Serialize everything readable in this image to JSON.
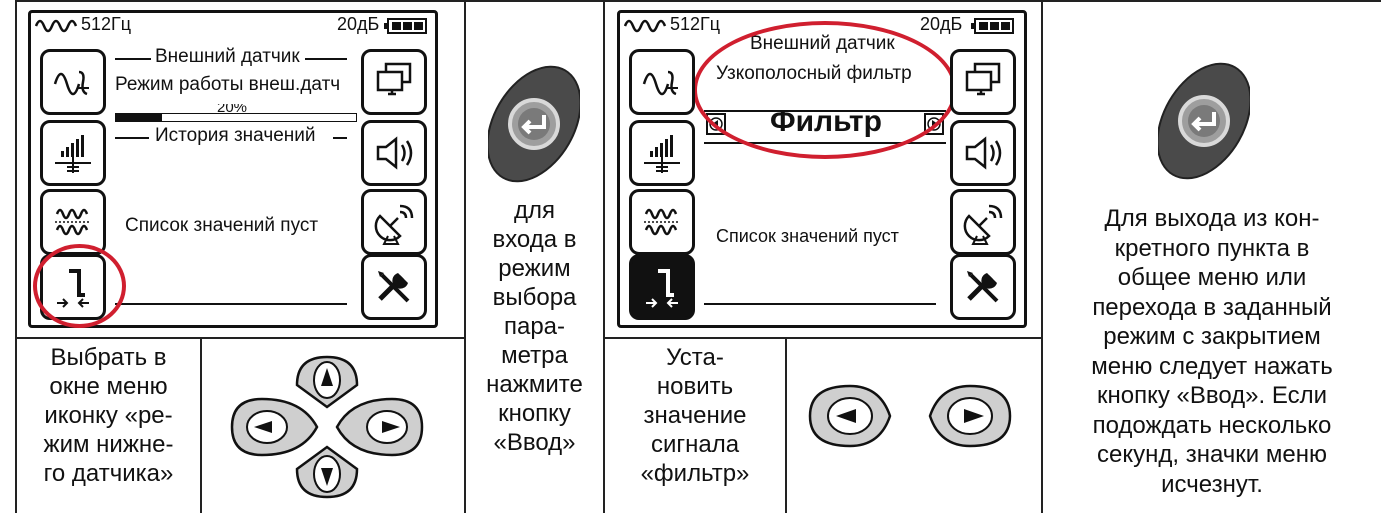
{
  "screen1": {
    "freq": "512Гц",
    "gain": "20дБ",
    "menu_title": "Внешний датчик",
    "menu_item": "Режим работы внеш.датч",
    "percent_partial": "20%",
    "history_title": "История значений",
    "empty_list": "Список значений пуст"
  },
  "screen2": {
    "freq": "512Гц",
    "gain": "20дБ",
    "menu_title": "Внешний датчик",
    "menu_item": "Узкополосный фильтр",
    "value": "Фильтр",
    "empty_list": "Список значений пуст"
  },
  "instructions": {
    "select_icon": "Выбрать в\nокне меню\nиконку «ре-\nжим нижне-\nго датчика»",
    "enter_mode": "для\nвхода в\nрежим\nвыбора\nпара-\nметра\nнажмите\nкнопку\n«Ввод»",
    "set_value": "Уста-\nновить\nзначение\nсигнала\n«фильтр»",
    "exit_text": "Для выхода из кон-\nкретного пункта в\nобщее меню или\nперехода в заданный\nрежим с закрытием\nменю следует нажать\nкнопку «Ввод». Если\nподождать несколько\nсекунд,  значки меню\nисчезнут."
  },
  "icons": {
    "left_buttons": [
      "waveform-icon",
      "signal-level-icon",
      "frequency-icon",
      "lower-sensor-icon"
    ],
    "right_buttons": [
      "display-icon",
      "speaker-icon",
      "satellite-icon",
      "tools-icon"
    ],
    "enter_key": "enter-button-icon",
    "nav_pad": "arrow-keypad-icon"
  },
  "colors": {
    "highlight": "#d01f2f",
    "enter_key_body": "#4a4a4a",
    "keypad_fill": "#cfcfcf"
  }
}
